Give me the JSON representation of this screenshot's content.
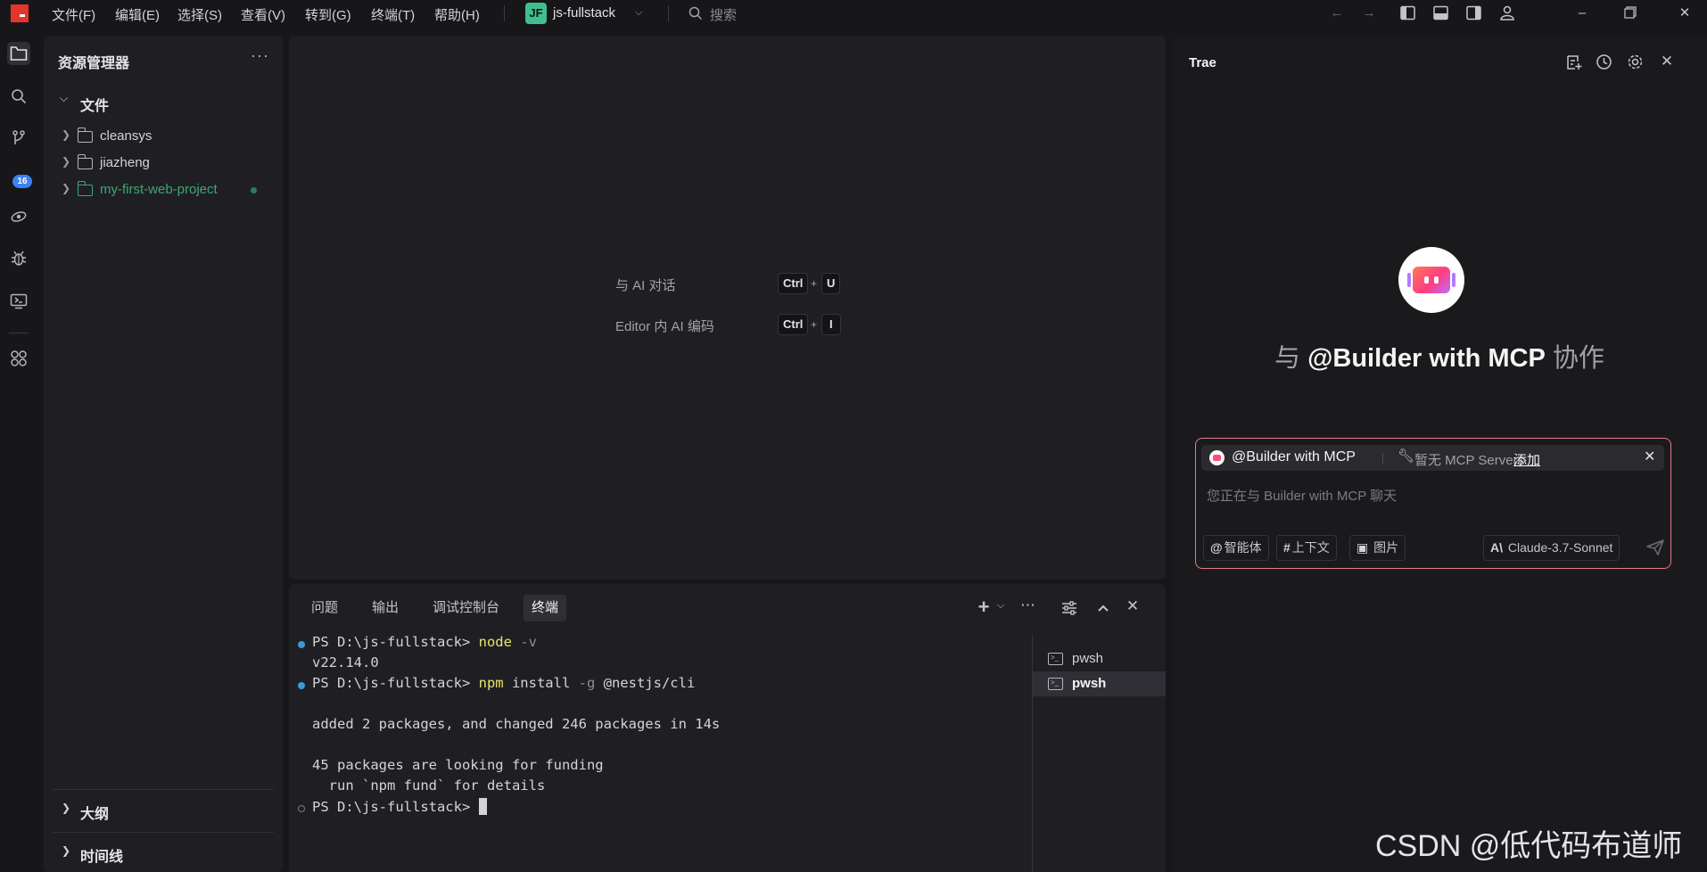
{
  "titlebar": {
    "menus": [
      "文件(F)",
      "编辑(E)",
      "选择(S)",
      "查看(V)",
      "转到(G)",
      "终端(T)",
      "帮助(H)"
    ],
    "project_badge": "JF",
    "project_name": "js-fullstack",
    "search_placeholder": "搜索",
    "icons": [
      "back-arrow-icon",
      "forward-arrow-icon",
      "toggle-left-sidebar-icon",
      "toggle-panel-icon",
      "toggle-right-sidebar-icon",
      "account-icon"
    ],
    "accent_color": "#e5352b"
  },
  "activitybar": {
    "items": [
      "explorer-icon",
      "search-icon",
      "source-control-icon",
      "remote-icon",
      "debug-icon",
      "remote-explorer-icon",
      "extensions-icon"
    ],
    "source_control_badge": "16"
  },
  "explorer": {
    "title": "资源管理器",
    "more": "···",
    "section_files": "文件",
    "folders": [
      {
        "name": "cleansys",
        "status": "normal"
      },
      {
        "name": "jiazheng",
        "status": "normal"
      },
      {
        "name": "my-first-web-project",
        "status": "modified"
      }
    ],
    "section_outline": "大纲",
    "section_timeline": "时间线"
  },
  "editor": {
    "hints": [
      {
        "label": "与 AI 对话",
        "keys": [
          "Ctrl",
          "U"
        ]
      },
      {
        "label": "Editor 内 AI 编码",
        "keys": [
          "Ctrl",
          "I"
        ]
      }
    ],
    "plus": "+"
  },
  "panel": {
    "tabs": [
      "问题",
      "输出",
      "调试控制台",
      "终端"
    ],
    "active_tab": "终端",
    "terminal": {
      "prompt": "PS D:\\js-fullstack> ",
      "lines": [
        {
          "cmd": "node",
          "args": " -v"
        },
        {
          "output": "v22.14.0"
        },
        {
          "cmd": "npm",
          "args_plain": " install ",
          "flag": "-g",
          "rest": " @nestjs/cli"
        },
        {
          "output": "added 2 packages, and changed 246 packages in 14s"
        },
        {
          "output": "45 packages are looking for funding"
        },
        {
          "output": "  run `npm fund` for details"
        }
      ]
    },
    "terminals": [
      "pwsh",
      "pwsh"
    ]
  },
  "trae": {
    "title": "Trae",
    "heading_prefix": "与",
    "heading_agent": "@Builder with MCP",
    "heading_suffix": "协作",
    "chip_agent": "@Builder with MCP",
    "chip_mcp": "暂无 MCP Servers",
    "chip_add": "添加",
    "placeholder": "您正在与 Builder with MCP 聊天",
    "btn_agent": "智能体",
    "btn_context": "上下文",
    "btn_image": "图片",
    "model": "Claude-3.7-Sonnet"
  },
  "watermark": "CSDN @低代码布道师"
}
